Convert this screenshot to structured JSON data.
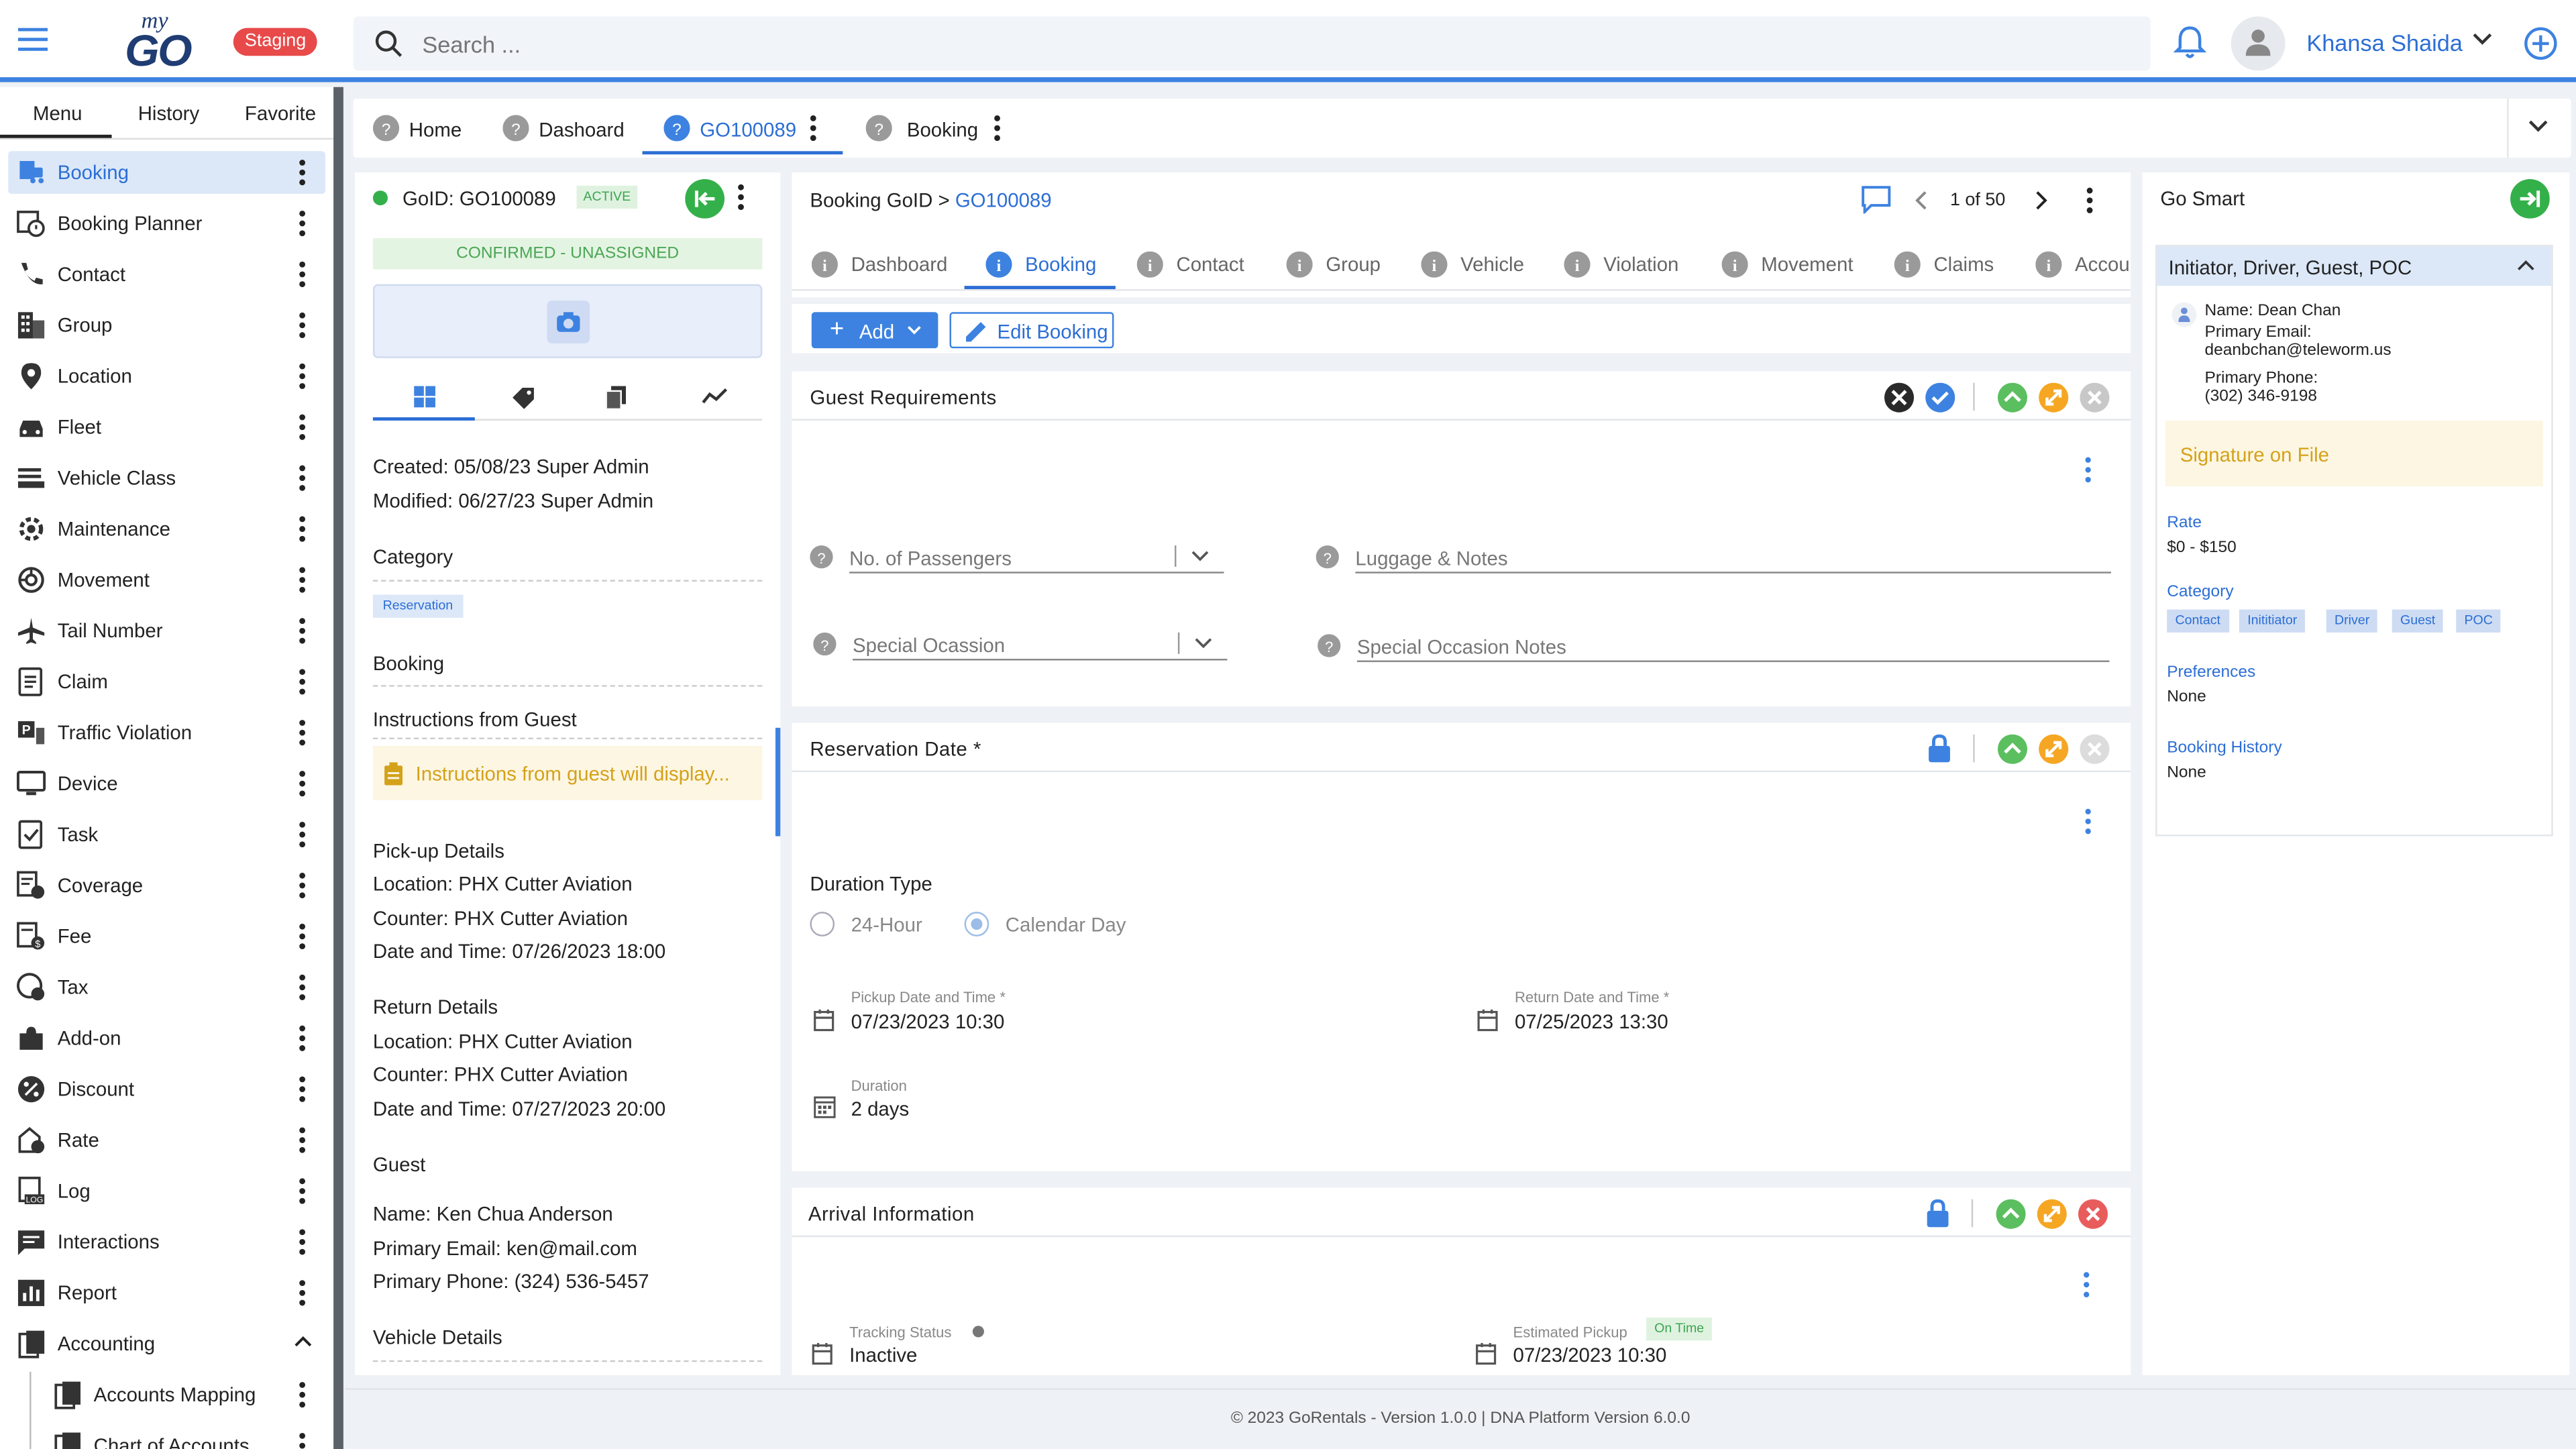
{
  "header": {
    "logo_my": "my",
    "logo_go": "GO",
    "env_badge": "Staging",
    "search_placeholder": "Search ...",
    "user_name": "Khansa Shaida"
  },
  "sidebar": {
    "tabs": [
      "Menu",
      "History",
      "Favorite"
    ],
    "items": [
      {
        "label": "Booking",
        "icon": "booking-icon"
      },
      {
        "label": "Booking Planner",
        "icon": "booking-planner-icon"
      },
      {
        "label": "Contact",
        "icon": "phone-icon"
      },
      {
        "label": "Group",
        "icon": "building-icon"
      },
      {
        "label": "Location",
        "icon": "location-pin-icon"
      },
      {
        "label": "Fleet",
        "icon": "car-icon"
      },
      {
        "label": "Vehicle Class",
        "icon": "vehicle-class-icon"
      },
      {
        "label": "Maintenance",
        "icon": "maintenance-icon"
      },
      {
        "label": "Movement",
        "icon": "movement-icon"
      },
      {
        "label": "Tail Number",
        "icon": "airplane-icon"
      },
      {
        "label": "Claim",
        "icon": "claim-icon"
      },
      {
        "label": "Traffic Violation",
        "icon": "traffic-violation-icon"
      },
      {
        "label": "Device",
        "icon": "device-icon"
      },
      {
        "label": "Task",
        "icon": "task-icon"
      },
      {
        "label": "Coverage",
        "icon": "coverage-icon"
      },
      {
        "label": "Fee",
        "icon": "fee-icon"
      },
      {
        "label": "Tax",
        "icon": "tax-icon"
      },
      {
        "label": "Add-on",
        "icon": "puzzle-icon"
      },
      {
        "label": "Discount",
        "icon": "percent-icon"
      },
      {
        "label": "Rate",
        "icon": "rate-icon"
      },
      {
        "label": "Log",
        "icon": "log-icon"
      },
      {
        "label": "Interactions",
        "icon": "chat-icon"
      },
      {
        "label": "Report",
        "icon": "report-icon"
      },
      {
        "label": "Accounting",
        "icon": "accounting-icon"
      }
    ],
    "sub_items": [
      {
        "label": "Accounts Mapping",
        "icon": "accounts-mapping-icon"
      },
      {
        "label": "Chart of Accounts",
        "icon": "chart-accounts-icon"
      }
    ]
  },
  "tabbar": {
    "tabs": [
      "Home",
      "Dashoard",
      "GO100089",
      "Booking"
    ]
  },
  "goid": {
    "title": "GoID: GO100089",
    "badge": "ACTIVE",
    "status": "CONFIRMED - UNASSIGNED",
    "created": "Created: 05/08/23 Super Admin",
    "modified": "Modified: 06/27/23 Super Admin",
    "category_heading": "Category",
    "category_chip": "Reservation",
    "booking_heading": "Booking",
    "instructions_heading": "Instructions from Guest",
    "instructions_text": "Instructions from guest will display...",
    "pickup_heading": "Pick-up Details",
    "pickup_location": "Location: PHX Cutter Aviation",
    "pickup_counter": "Counter: PHX Cutter Aviation",
    "pickup_datetime": "Date and Time: 07/26/2023 18:00",
    "return_heading": "Return Details",
    "return_location": "Location: PHX Cutter Aviation",
    "return_counter": "Counter: PHX Cutter Aviation",
    "return_datetime": "Date and Time: 07/27/2023 20:00",
    "guest_heading": "Guest",
    "guest_name": "Name: Ken Chua Anderson",
    "guest_email": "Primary Email: ken@mail.com",
    "guest_phone": "Primary Phone: (324) 536-5457",
    "vehicle_heading": "Vehicle Details"
  },
  "booking": {
    "breadcrumb_prefix": "Booking GoID > ",
    "breadcrumb_link": "GO100089",
    "pager": "1 of 50",
    "tabs": [
      "Dashboard",
      "Booking",
      "Contact",
      "Group",
      "Vehicle",
      "Violation",
      "Movement",
      "Claims",
      "Accou"
    ],
    "add_label": "Add",
    "edit_label": "Edit Booking"
  },
  "guest_req": {
    "title": "Guest Requirements",
    "passengers_label": "No. of Passengers",
    "luggage_label": "Luggage & Notes",
    "occasion_label": "Special Ocassion",
    "occasion_notes_label": "Special Occasion Notes"
  },
  "reservation": {
    "title": "Reservation Date *",
    "duration_type_label": "Duration Type",
    "option_24h": "24-Hour",
    "option_calendar": "Calendar Day",
    "pickup_label": "Pickup Date and Time *",
    "pickup_value": "07/23/2023 10:30",
    "return_label": "Return Date and Time *",
    "return_value": "07/25/2023 13:30",
    "duration_label": "Duration",
    "duration_value": "2 days"
  },
  "arrival": {
    "title": "Arrival Information",
    "tracking_label": "Tracking Status",
    "tracking_value": "Inactive",
    "est_pickup_label": "Estimated Pickup",
    "on_time": "On Time",
    "est_pickup_value": "07/23/2023 10:30"
  },
  "gosmart": {
    "title": "Go Smart",
    "card_title": "Initiator, Driver, Guest, POC",
    "name": "Name: Dean Chan",
    "email_label": "Primary Email:",
    "email_value": "deanbchan@teleworm.us",
    "phone_label": "Primary Phone:",
    "phone_value": "(302) 346-9198",
    "signature": "Signature on File",
    "rate_label": "Rate",
    "rate_value": "$0 - $150",
    "category_label": "Category",
    "chips": [
      "Contact",
      "Inititiator",
      "Driver",
      "Guest",
      "POC"
    ],
    "preferences_label": "Preferences",
    "preferences_value": "None",
    "history_label": "Booking History",
    "history_value": "None"
  },
  "footer": {
    "text": "©   2023 GoRentals - Version 1.0.0 | DNA Platform Version 6.0.0"
  },
  "colors": {
    "accent": "#3d82e0",
    "success": "#34b04a",
    "warning": "#f5a623",
    "danger": "#e85c5c",
    "staging": "#e84a4a"
  }
}
